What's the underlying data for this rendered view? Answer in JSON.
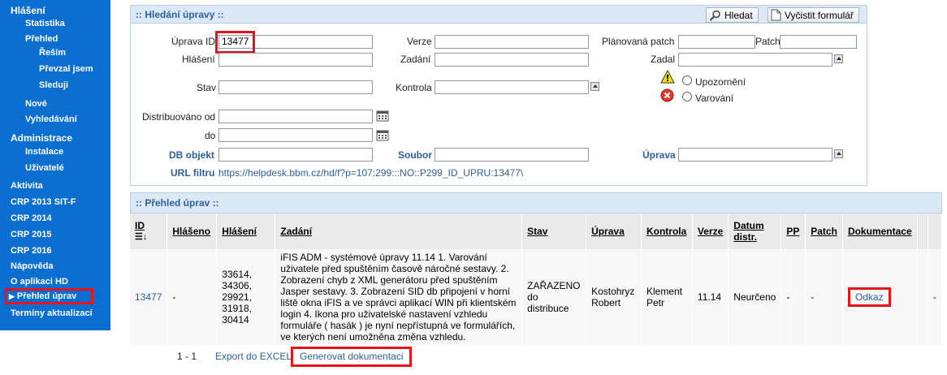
{
  "sidebar": {
    "hlaseni": "Hlášení",
    "statistika": "Statistika",
    "prehled": "Přehled",
    "resim": "Řeším",
    "prevzal": "Převzal jsem",
    "sleduji": "Sleduji",
    "nove": "Nové",
    "vyhledavani": "Vyhledávání",
    "administrace": "Administrace",
    "instalace": "Instalace",
    "uzivatele": "Uživatelé",
    "aktivita": "Aktivita",
    "crp2013": "CRP 2013 SIT-F",
    "crp2014": "CRP 2014",
    "crp2015": "CRP 2015",
    "crp2016": "CRP 2016",
    "napoveda": "Nápověda",
    "oaplikaci": "O aplikaci HD",
    "prehled_uprav": "Přehled úprav",
    "terminy": "Termíny aktualizací"
  },
  "search": {
    "title": ":: Hledání úpravy ::",
    "btn_search": "Hledat",
    "btn_clear": "Vyčistit formulář",
    "labels": {
      "uprava_id": "Úprava ID",
      "hlaseni": "Hlášení",
      "stav": "Stav",
      "distribuovano_od": "Distribuováno od",
      "do": "do",
      "db_objekt": "DB objekt",
      "url_filtru": "URL filtru",
      "verze": "Verze",
      "zadani": "Zadání",
      "kontrola": "Kontrola",
      "soubor": "Soubor",
      "planovana_patch": "Plánovaná patch",
      "patch": "Patch",
      "zadal": "Zadal",
      "upozorneni": "Upozornění",
      "varovani": "Varování",
      "uprava": "Úprava"
    },
    "values": {
      "uprava_id": "13477",
      "url": "https://helpdesk.bbm.cz/hd/f?p=107:299:::NO::P299_ID_UPRU:13477\\"
    }
  },
  "list": {
    "title": ":: Přehled úprav ::",
    "columns": [
      "ID",
      "Hlášeno",
      "Hlášení",
      "Zadání",
      "Stav",
      "Úprava",
      "Kontrola",
      "Verze",
      "Datum distr.",
      "PP",
      "Patch",
      "Dokumentace"
    ],
    "row": {
      "id": "13477",
      "hlaseno": "-",
      "hlaseni": "33614, 34306, 29921, 31918, 30414",
      "zadani": "iFIS ADM - systémové úpravy 11.14 1. Varování uživatele před spuštěním časově náročné sestavy. 2. Zobrazení chyb z XML generátoru před spuštěním Jasper sestavy. 3. Zobrazení SID db připojení v horní liště okna iFIS a ve správci aplikací WIN při klientském login 4. Ikona pro uživatelské nastavení vzhledu formuláře ( hasák ) je nyní nepřístupná ve formulářích, ve kterých není umožněna změna vzhledu.",
      "stav": "ZAŘAZENO do distribuce",
      "uprava": "Kostohryz Robert",
      "kontrola": "Klement Petr",
      "verze": "11.14",
      "datum": "Neurčeno",
      "pp": "-",
      "patch": "-",
      "dokumentace": "Odkaz",
      "extra": "-"
    }
  },
  "footer": {
    "range": "1 - 1",
    "export": "Export do EXCEL",
    "generate": "Generovat dokumentaci"
  },
  "colors": {
    "sidebar": "#0a6fd0",
    "highlight": "#e8141c",
    "panel_head": "#dbe8f5",
    "link": "#2d5f9a"
  }
}
